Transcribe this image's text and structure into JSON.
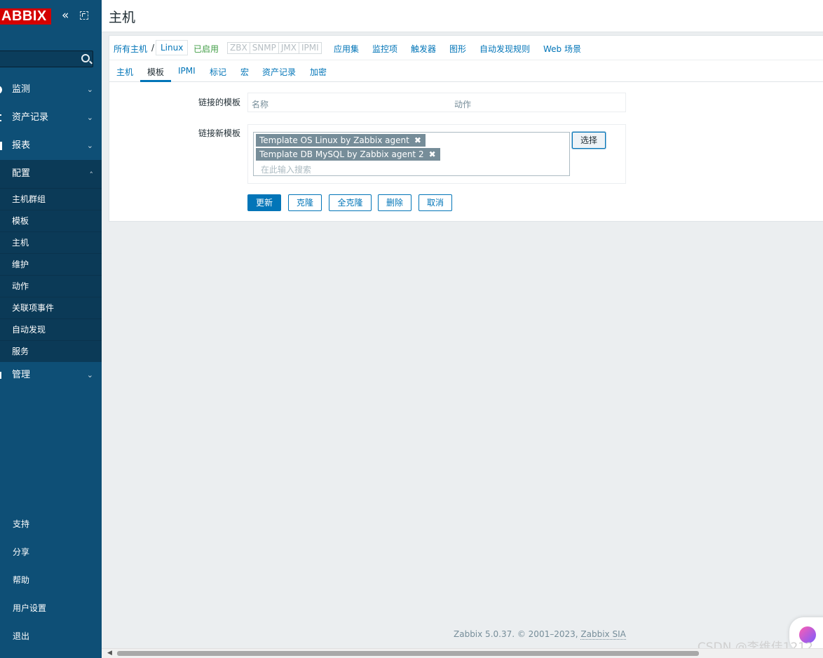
{
  "app": {
    "logo": "ABBIX",
    "collapse_glyph": "«"
  },
  "sidebar": {
    "menu": [
      {
        "label": "监测"
      },
      {
        "label": "资产记录"
      },
      {
        "label": "报表"
      },
      {
        "label": "配置"
      },
      {
        "label": "管理"
      }
    ],
    "config_items": [
      "主机群组",
      "模板",
      "主机",
      "维护",
      "动作",
      "关联项事件",
      "自动发现",
      "服务"
    ],
    "bottom": [
      "支持",
      "分享",
      "帮助",
      "用户设置",
      "退出"
    ]
  },
  "header": {
    "title": "主机"
  },
  "filter_bar": {
    "all_hosts": "所有主机",
    "sep": "/",
    "current": "Linux",
    "enabled": "已启用",
    "availability": [
      "ZBX",
      "SNMP",
      "JMX",
      "IPMI"
    ],
    "links": [
      "应用集",
      "监控项",
      "触发器",
      "图形",
      "自动发现规则",
      "Web 场景"
    ]
  },
  "tabs": [
    "主机",
    "模板",
    "IPMI",
    "标记",
    "宏",
    "资产记录",
    "加密"
  ],
  "form": {
    "linked_label": "链接的模板",
    "col_name": "名称",
    "col_action": "动作",
    "new_label": "链接新模板",
    "chips": [
      "Template OS Linux by Zabbix agent",
      "Template DB MySQL by Zabbix agent 2"
    ],
    "chip_remove": "✖",
    "search_placeholder": "在此输入搜索",
    "select_button": "选择"
  },
  "buttons": {
    "update": "更新",
    "clone": "克隆",
    "full_clone": "全克隆",
    "delete": "删除",
    "cancel": "取消"
  },
  "footer": {
    "text": "Zabbix 5.0.37. © 2001–2023, ",
    "link": "Zabbix SIA"
  },
  "watermark": "CSDN @李维佳1212"
}
